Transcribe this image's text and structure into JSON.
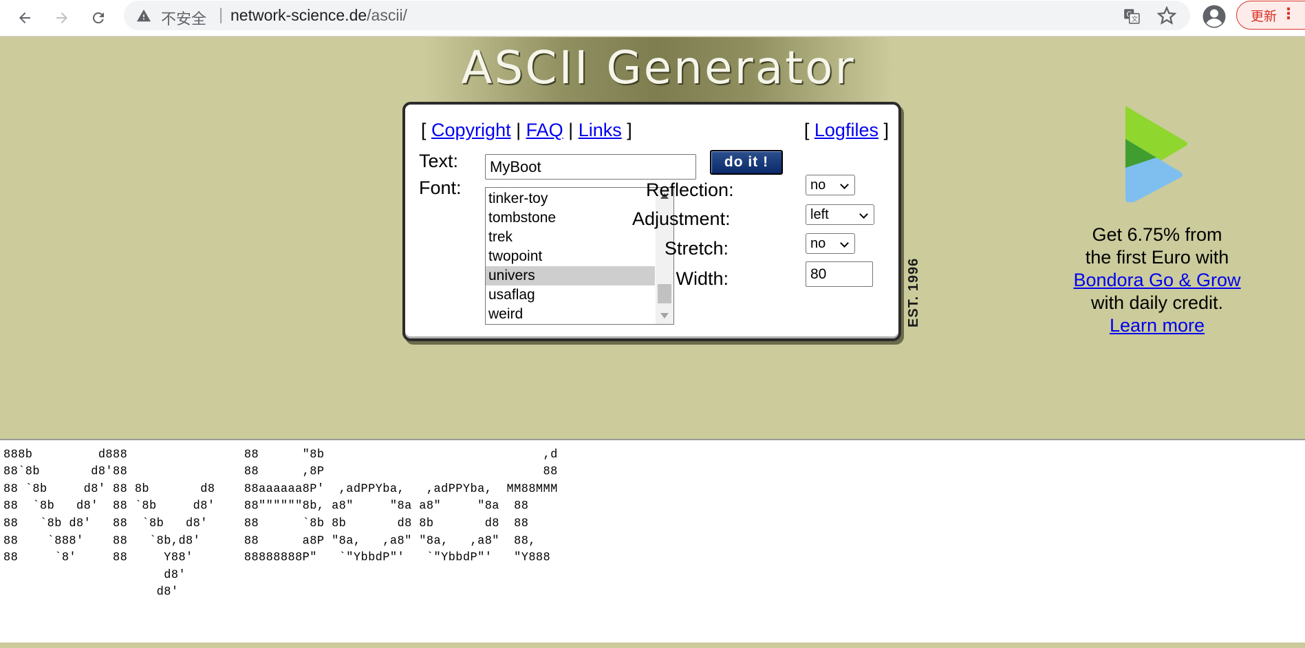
{
  "browser": {
    "insecure_label": "不安全",
    "url_host": "network-science.de",
    "url_path": "/ascii/",
    "update_label": "更新"
  },
  "site": {
    "title": "ASCII Generator",
    "est": "EST. 1996"
  },
  "nav_links": {
    "open_bracket": "[",
    "copyright": "Copyright",
    "pipe1": "|",
    "faq": "FAQ",
    "pipe2": "|",
    "links": "Links",
    "close_bracket": "]",
    "logfiles": "Logfiles"
  },
  "form": {
    "text_label": "Text:",
    "text_value": "MyBoot",
    "do_it_label": "do it !",
    "font_label": "Font:",
    "fonts": [
      "tinker-toy",
      "tombstone",
      "trek",
      "twopoint",
      "univers",
      "usaflag",
      "weird"
    ],
    "selected_font": "univers",
    "reflection_label": "Reflection:",
    "reflection_value": "no",
    "adjustment_label": "Adjustment:",
    "adjustment_value": "left",
    "stretch_label": "Stretch:",
    "stretch_value": "no",
    "width_label": "Width:",
    "width_value": "80"
  },
  "ad": {
    "line1": "Get 6.75% from",
    "line2": "the first Euro with",
    "link1": "Bondora Go & Grow",
    "line3": "with daily credit.",
    "link2": "Learn more",
    "colors": {
      "green": "#8fd62e",
      "dark_green": "#3f9e2f",
      "blue": "#7fbff0"
    }
  },
  "output": {
    "ascii": "888           d88                888888888a\n888b         d888                88      \"8b                              ,d\n88`8b       d8'88                88      ,8P                              88\n88 `8b     d8' 88 8b       d8    88aaaaaa8P'  ,adPPYba,   ,adPPYba,  MM88MMM\n88  `8b   d8'  88 `8b     d8'    88\"\"\"\"\"\"8b, a8\"     \"8a a8\"     \"8a  88\n88   `8b d8'   88  `8b   d8'     88      `8b 8b       d8 8b       d8  88\n88    `888'    88   `8b,d8'      88      a8P \"8a,   ,a8\" \"8a,   ,a8\"  88,\n88     `8'     88     Y88'       88888888P\"   `\"YbbdP\"'   `\"YbbdP\"'   \"Y888\n                      d8'\n                     d8'"
  }
}
